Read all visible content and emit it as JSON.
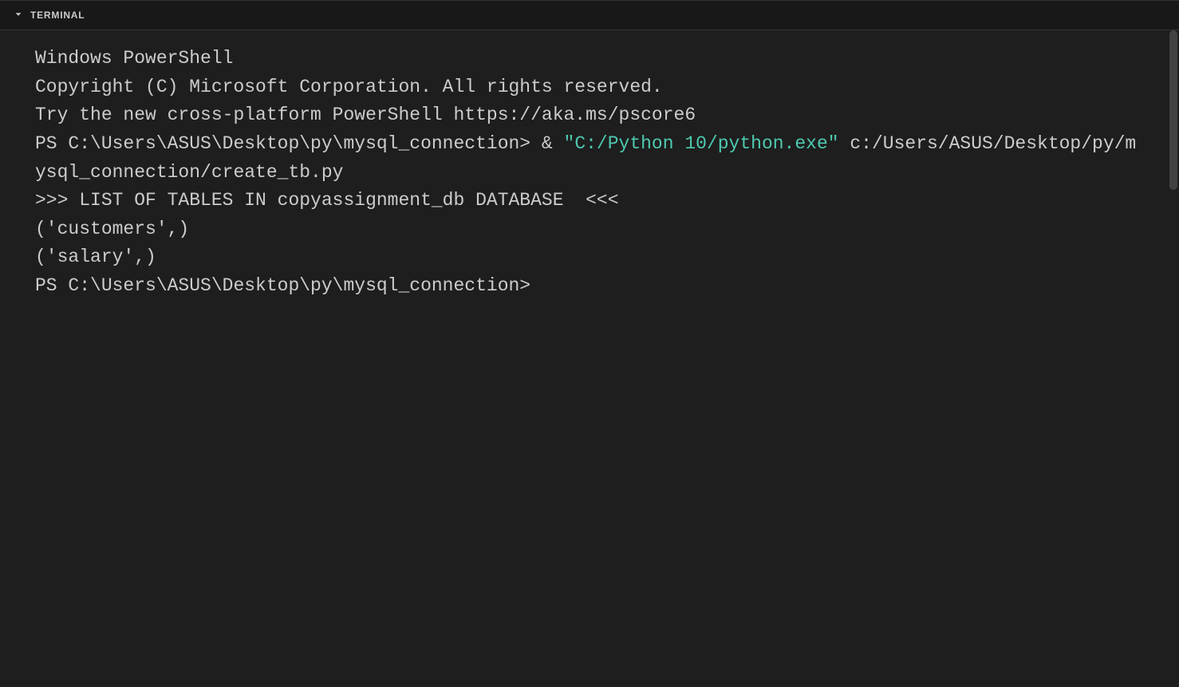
{
  "panel": {
    "title": "TERMINAL"
  },
  "terminal": {
    "line1": "Windows PowerShell",
    "line2": "Copyright (C) Microsoft Corporation. All rights reserved.",
    "blank1": "",
    "line3": "Try the new cross-platform PowerShell https://aka.ms/pscore6",
    "blank2": "",
    "prompt1_prefix": "PS C:\\Users\\ASUS\\Desktop\\py\\mysql_connection> & ",
    "prompt1_highlight": "\"C:/Python 10/python.exe\"",
    "prompt1_suffix": " c:/Users/ASUS/Desktop/py/mysql_connection/create_tb.py",
    "blank3": "",
    "blank4": "",
    "output_header": ">>> LIST OF TABLES IN copyassignment_db DATABASE  <<<",
    "output_row1": "('customers',)",
    "output_row2": "('salary',)",
    "prompt2": "PS C:\\Users\\ASUS\\Desktop\\py\\mysql_connection>"
  }
}
